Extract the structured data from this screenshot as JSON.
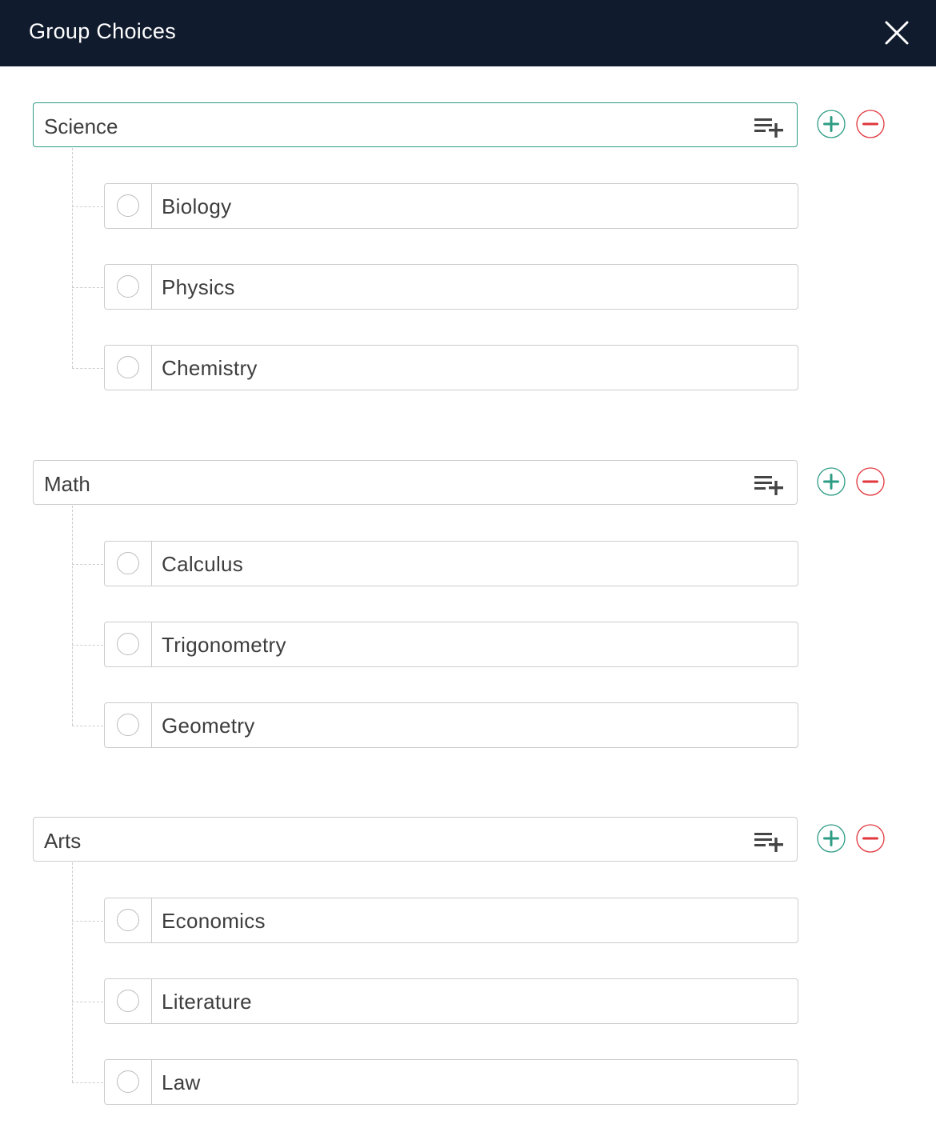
{
  "dialog": {
    "title": "Group Choices",
    "close_icon": "close-icon"
  },
  "colors": {
    "header_bg": "#101b2d",
    "accent_green": "#2e9c84",
    "danger_red": "#e0363c",
    "border": "#cccccc",
    "text": "#3d3d3d"
  },
  "groups": [
    {
      "label": "Science",
      "focused": true,
      "choices": [
        {
          "label": "Biology",
          "selected": false
        },
        {
          "label": "Physics",
          "selected": false
        },
        {
          "label": "Chemistry",
          "selected": false
        }
      ]
    },
    {
      "label": "Math",
      "focused": false,
      "choices": [
        {
          "label": "Calculus",
          "selected": false
        },
        {
          "label": "Trigonometry",
          "selected": false
        },
        {
          "label": "Geometry",
          "selected": false
        }
      ]
    },
    {
      "label": "Arts",
      "focused": false,
      "choices": [
        {
          "label": "Economics",
          "selected": false
        },
        {
          "label": "Literature",
          "selected": false
        },
        {
          "label": "Law",
          "selected": false
        }
      ]
    }
  ],
  "icons": {
    "add_choice": "playlist-add-icon",
    "add_group": "plus-circle-icon",
    "remove_group": "minus-circle-icon"
  }
}
